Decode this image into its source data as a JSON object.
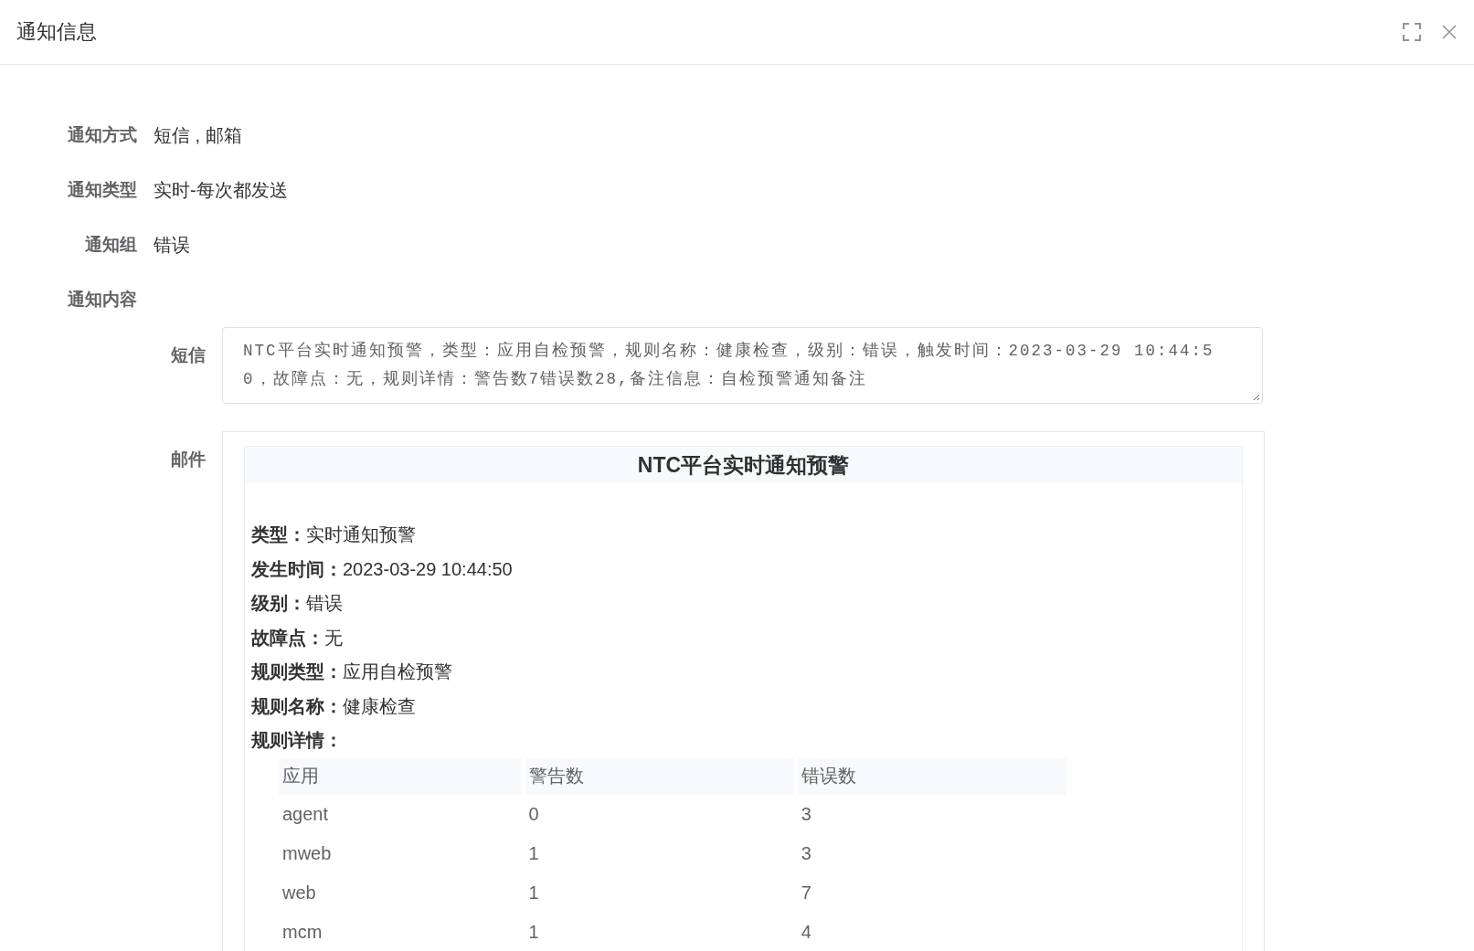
{
  "dialog": {
    "title": "通知信息"
  },
  "fields": [
    {
      "label": "通知方式",
      "value": "短信 , 邮箱"
    },
    {
      "label": "通知类型",
      "value": "实时-每次都发送"
    },
    {
      "label": "通知组",
      "value": "错误"
    }
  ],
  "content": {
    "label": "通知内容",
    "sms": {
      "label": "短信",
      "text": "NTC平台实时通知预警，类型：应用自检预警，规则名称：健康检查，级别：错误，触发时间：2023-03-29 10:44:50，故障点：无，规则详情：警告数7错误数28,备注信息：自检预警通知备注"
    },
    "mail": {
      "label": "邮件",
      "heading": "NTC平台实时通知预警",
      "lines": [
        {
          "label": "类型：",
          "value": "实时通知预警"
        },
        {
          "label": "发生时间：",
          "value": "2023-03-29 10:44:50"
        },
        {
          "label": "级别：",
          "value": "错误"
        },
        {
          "label": "故障点：",
          "value": "无"
        },
        {
          "label": "规则类型：",
          "value": "应用自检预警"
        },
        {
          "label": "规则名称：",
          "value": "健康检查"
        },
        {
          "label": "规则详情："
        }
      ],
      "table": {
        "columns": [
          "应用",
          "警告数",
          "错误数"
        ],
        "rows": [
          [
            "agent",
            "0",
            "3"
          ],
          [
            "mweb",
            "1",
            "3"
          ],
          [
            "web",
            "1",
            "7"
          ],
          [
            "mcm",
            "1",
            "4"
          ]
        ]
      }
    }
  }
}
